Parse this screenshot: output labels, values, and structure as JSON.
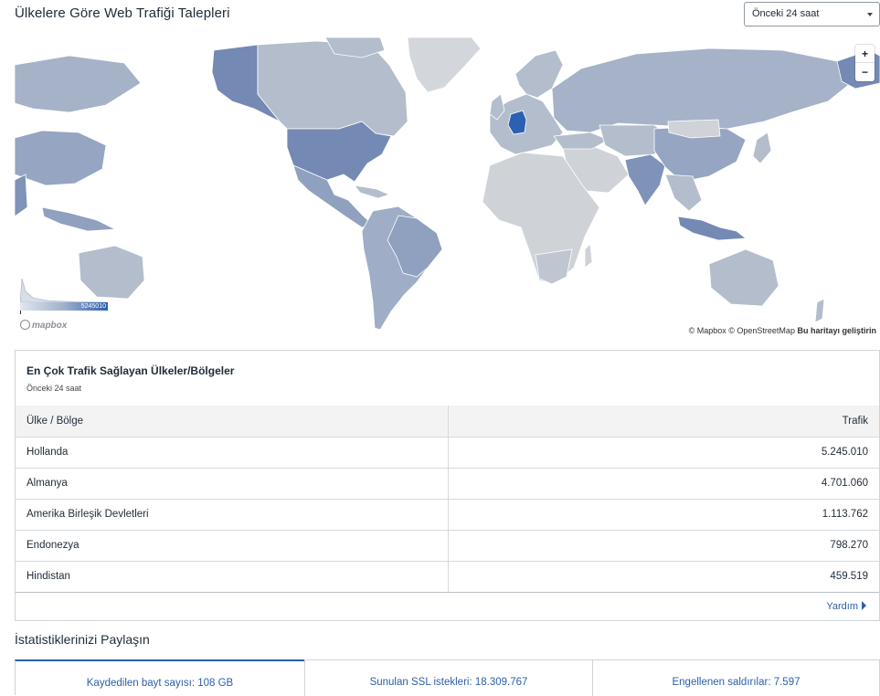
{
  "header": {
    "title": "Ülkelere Göre Web Trafiği Talepleri",
    "time_range": "Önceki 24 saat"
  },
  "map": {
    "zoom_in": "+",
    "zoom_out": "−",
    "legend_max": "5245010",
    "logo": "mapbox",
    "attribution": "© Mapbox © OpenStreetMap",
    "improve_link": "Bu haritayı geliştirin",
    "colors": {
      "ocean": "#ffffff",
      "no_data": "#cfd3d8",
      "low": "#b3bdcc",
      "mid": "#8fa1bf",
      "high": "#7489b4",
      "top": "#2c60b3"
    }
  },
  "panel": {
    "title": "En Çok Trafik Sağlayan Ülkeler/Bölgeler",
    "subtitle": "Önceki 24 saat",
    "columns": {
      "country": "Ülke / Bölge",
      "traffic": "Trafik"
    },
    "rows": [
      {
        "country": "Hollanda",
        "traffic": "5.245.010"
      },
      {
        "country": "Almanya",
        "traffic": "4.701.060"
      },
      {
        "country": "Amerika Birleşik Devletleri",
        "traffic": "1.113.762"
      },
      {
        "country": "Endonezya",
        "traffic": "798.270"
      },
      {
        "country": "Hindistan",
        "traffic": "459.519"
      }
    ],
    "help": "Yardım"
  },
  "share": {
    "title": "İstatistiklerinizi Paylaşın",
    "tabs": [
      "Kaydedilen bayt sayısı: 108 GB",
      "Sunulan SSL istekleri: 18.309.767",
      "Engellenen saldırılar: 7.597"
    ]
  }
}
